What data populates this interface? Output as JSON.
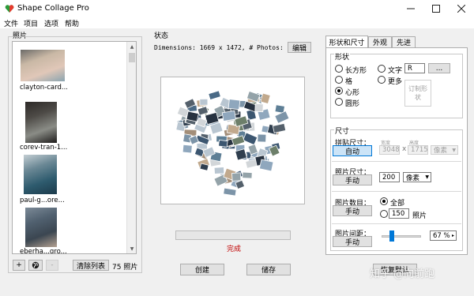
{
  "window": {
    "title": "Shape Collage Pro"
  },
  "menu": [
    "文件",
    "项目",
    "选项",
    "帮助"
  ],
  "photos_panel": {
    "label": "照片",
    "items": [
      {
        "caption": "clayton-card...",
        "colors": [
          "#6b6a68",
          "#c9b8a5",
          "#e0c7b8",
          "#8aa4b0"
        ]
      },
      {
        "caption": "corev-tran-1...",
        "colors": [
          "#2d2a28",
          "#4d4a46",
          "#8a8c86",
          "#1d1b1a"
        ]
      },
      {
        "caption": "paul-g...ore...",
        "colors": [
          "#c4cfd4",
          "#6b8895",
          "#2e5b6e",
          "#1c3a4a"
        ]
      },
      {
        "caption": "eberha...gro...",
        "colors": [
          "#7c8a97",
          "#516170",
          "#3b4651",
          "#b4a191"
        ]
      }
    ],
    "add_label": "+",
    "web_label": "◍",
    "remove_label": "-",
    "clear_label": "清除列表",
    "count_label": "75 照片"
  },
  "status_panel": {
    "label": "状态",
    "dimensions_text": "Dimensions: 1669 x 1472, # Photos: 75",
    "edit_label": "编辑",
    "progress": 1.0,
    "status_text": "完成",
    "create_label": "创建",
    "save_label": "储存"
  },
  "tabs": [
    "形状和尺寸",
    "外观",
    "先进"
  ],
  "shape_group": {
    "label": "形状",
    "options": [
      {
        "label": "长方形",
        "checked": false
      },
      {
        "label": "格",
        "checked": false
      },
      {
        "label": "心形",
        "checked": true
      },
      {
        "label": "圆形",
        "checked": false
      },
      {
        "label": "文字",
        "checked": false
      },
      {
        "label": "更多",
        "checked": false
      }
    ],
    "text_value": "R",
    "more_button": "...",
    "custom_button": "订制形状"
  },
  "size_group": {
    "label": "尺寸",
    "collage_size_label": "拼贴尺寸：",
    "collage_size_button": "自动",
    "width_label": "宽度",
    "height_label": "高度",
    "width_value": "3048",
    "x_label": "x",
    "height_value": "1715",
    "unit_disabled": "像素",
    "photo_size_label": "照片尺寸：",
    "photo_size_button": "手动",
    "photo_size_value": "200",
    "photo_unit": "像素",
    "photo_count_label": "图片数目：",
    "photo_count_button": "手动",
    "all_label": "全部",
    "count_value": "150",
    "count_unit": "照片",
    "spacing_label": "图片间距：",
    "spacing_button": "手动",
    "spacing_value": 0.2,
    "spacing_percent": "67 %"
  },
  "defaults_button": "恢复默认",
  "watermark": "知乎 @向前跑"
}
